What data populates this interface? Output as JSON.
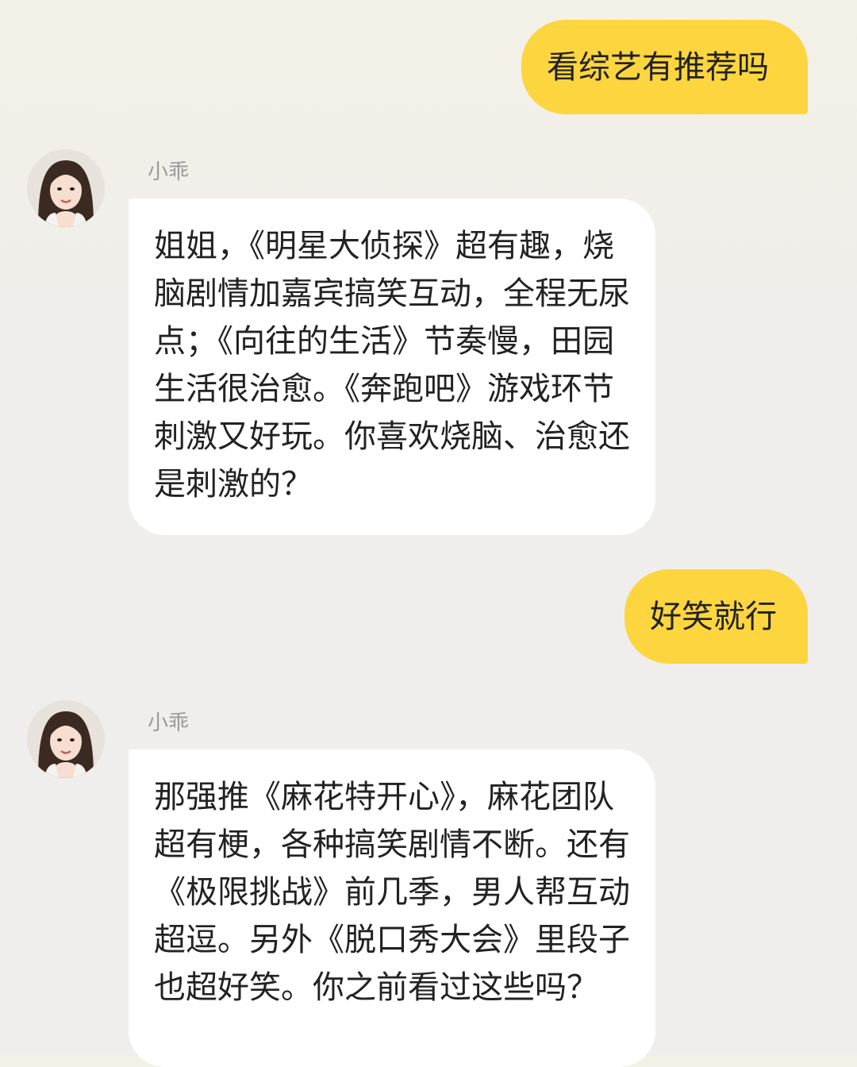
{
  "messages": [
    {
      "role": "user",
      "text": "看综艺有推荐吗"
    },
    {
      "role": "assistant",
      "sender": "小乖",
      "avatar": "girl-avatar",
      "text": "姐姐，《明星大侦探》超有趣，烧脑剧情加嘉宾搞笑互动，全程无尿点；《向往的生活》节奏慢，田园生活很治愈。《奔跑吧》游戏环节刺激又好玩。你喜欢烧脑、治愈还是刺激的？"
    },
    {
      "role": "user",
      "text": "好笑就行"
    },
    {
      "role": "assistant",
      "sender": "小乖",
      "avatar": "girl-avatar",
      "text": "那强推《麻花特开心》，麻花团队超有梗，各种搞笑剧情不断。还有《极限挑战》前几季，男人帮互动超逗。另外《脱口秀大会》里段子也超好笑。你之前看过这些吗？"
    }
  ],
  "colors": {
    "user_bubble": "#fcd53f",
    "assistant_bubble": "#ffffff",
    "background": "#efeeed"
  }
}
